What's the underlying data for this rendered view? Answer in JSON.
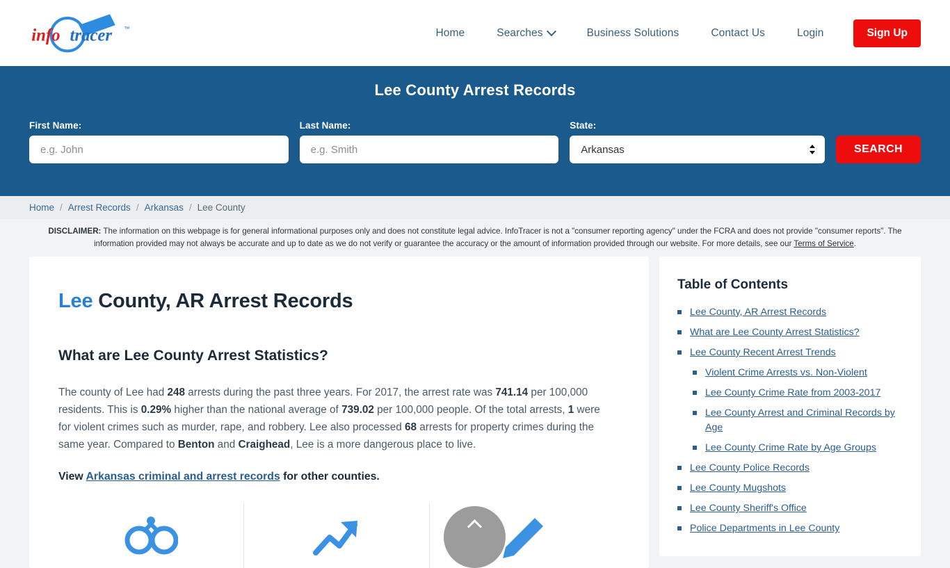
{
  "header": {
    "logo_alt": "infotracer",
    "logo_text_info": "info",
    "logo_text_tracer": "tracer",
    "logo_tm": "™",
    "nav": [
      {
        "label": "Home"
      },
      {
        "label": "Searches"
      },
      {
        "label": "Business Solutions"
      },
      {
        "label": "Contact Us"
      },
      {
        "label": "Login"
      }
    ],
    "signup_label": "Sign Up"
  },
  "search_band": {
    "title": "Lee County Arrest Records",
    "first_name_label": "First Name:",
    "first_name_placeholder": "e.g. John",
    "first_name_value": "",
    "last_name_label": "Last Name:",
    "last_name_placeholder": "e.g. Smith",
    "last_name_value": "",
    "state_label": "State:",
    "state_value": "Arkansas",
    "state_options": [
      "Arkansas"
    ],
    "search_label": "SEARCH"
  },
  "breadcrumb": {
    "items": [
      {
        "label": "Home",
        "current": false
      },
      {
        "label": "Arrest Records",
        "current": false
      },
      {
        "label": "Arkansas",
        "current": false
      },
      {
        "label": "Lee County",
        "current": true
      }
    ],
    "separator": "/"
  },
  "disclaimer": {
    "prefix": "DISCLAIMER:",
    "body": " The information on this webpage is for general informational purposes only and does not constitute legal advice. InfoTracer is not a \"consumer reporting agency\" under the FCRA and does not provide \"consumer reports\". The information provided may not always be accurate and up to date as we do not verify or guarantee the accuracy or the amount of information provided through our website. For more details, see our ",
    "link_label": "Terms of Service",
    "suffix": "."
  },
  "main": {
    "title_highlight": "Lee",
    "title_rest": " County, AR Arrest Records",
    "section_heading": "What are Lee County Arrest Statistics?",
    "paragraph": {
      "p1": "The county of Lee had ",
      "arrests_total": "248",
      "p2": " arrests during the past three years. For 2017, the arrest rate was ",
      "arrest_rate": "741.14",
      "p3": " per 100,000 residents. This is ",
      "pct_higher": "0.29%",
      "p4": " higher than the national average of ",
      "national_average": "739.02",
      "p5": " per 100,000 people. Of the total arrests, ",
      "violent_arrests": "1",
      "p6": " were for violent crimes such as murder, rape, and robbery. Lee also processed ",
      "property_arrests": "68",
      "p7": " arrests for property crimes during the same year. Compared to ",
      "compare_county_1": "Benton",
      "p8": " and ",
      "compare_county_2": "Craighead",
      "p9": ", Lee is a more dangerous place to live."
    },
    "view_line": {
      "prefix": "View ",
      "link_label": "Arkansas criminal and arrest records",
      "suffix": " for other counties."
    },
    "stat_icons": [
      {
        "name": "handcuffs-icon"
      },
      {
        "name": "trending-up-arrow-icon"
      },
      {
        "name": "pen-icon"
      }
    ]
  },
  "toc": {
    "title": "Table of Contents",
    "items": [
      {
        "label": "Lee County, AR Arrest Records",
        "level": 1
      },
      {
        "label": "What are Lee County Arrest Statistics?",
        "level": 1
      },
      {
        "label": "Lee County Recent Arrest Trends",
        "level": 1
      },
      {
        "label": "Violent Crime Arrests vs. Non-Violent",
        "level": 2
      },
      {
        "label": "Lee County Crime Rate from 2003-2017",
        "level": 2
      },
      {
        "label": "Lee County Arrest and Criminal Records by Age",
        "level": 2
      },
      {
        "label": "Lee County Crime Rate by Age Groups",
        "level": 2
      },
      {
        "label": "Lee County Police Records",
        "level": 1
      },
      {
        "label": "Lee County Mugshots",
        "level": 1
      },
      {
        "label": "Lee County Sheriff's Office",
        "level": 1
      },
      {
        "label": "Police Departments in Lee County",
        "level": 1
      }
    ]
  },
  "scroll_top": {
    "label": ""
  },
  "colors": {
    "brand_blue": "#1b5a8c",
    "accent_red": "#ee0d0d",
    "link_blue": "#2b5d8f",
    "highlight_blue": "#2680d6",
    "page_bg": "#f1f3f5"
  }
}
